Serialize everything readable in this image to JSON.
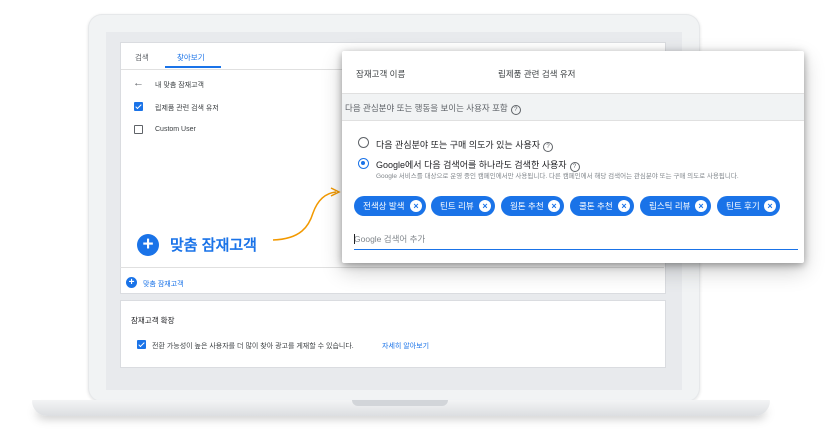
{
  "tabs": [
    {
      "label": "검색"
    },
    {
      "label": "찾아보기"
    }
  ],
  "audience_list": {
    "header": "내 맞춤 잠재고객",
    "items": [
      {
        "label": "립제품 관련 검색 유저",
        "checked": true
      },
      {
        "label": "Custom User",
        "checked": false
      }
    ]
  },
  "big_add_label": "맞춤 잠재고객",
  "small_add_label": "맞춤 잠재고객",
  "expansion": {
    "title": "잠재고객 확장",
    "checkbox_label": "전환 가능성이 높은 사용자를 더 많이 찾아 광고를 게재할 수 있습니다.",
    "learn_more": "자세히 알아보기"
  },
  "dialog": {
    "name_label": "잠재고객 이름",
    "name_value": "립제품 관련 검색 유저",
    "include_text": "다음 관심분야 또는 행동을 보이는 사용자 포함",
    "option1": "다음 관심분야 또는 구매 의도가 있는 사용자",
    "option2": "Google에서 다음 검색어를 하나라도 검색한 사용자",
    "option2_sub": "Google 서비스를 대상으로 운영 중인 캠페인에서만 사용됩니다. 다른 캠페인에서 해당 검색어는 관심분야 또는 구매 의도로 사용됩니다.",
    "chips": [
      "전색상 발색",
      "틴트 리뷰",
      "웜톤 추천",
      "쿨톤 추천",
      "립스틱 리뷰",
      "틴트 후기"
    ],
    "input_placeholder": "Google 검색어 추가"
  },
  "colors": {
    "accent": "#1a73e8",
    "arrow": "#f29900"
  }
}
